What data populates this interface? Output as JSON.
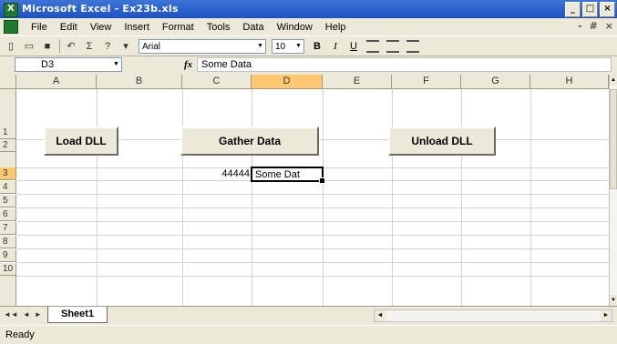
{
  "window": {
    "title": "Microsoft Excel - Ex23b.xls",
    "controls": {
      "minimize": "_",
      "restore": "□",
      "close": "×"
    }
  },
  "menu": {
    "items": [
      "File",
      "Edit",
      "View",
      "Insert",
      "Format",
      "Tools",
      "Data",
      "Window",
      "Help"
    ],
    "doc_controls": {
      "minimize": "-",
      "restore": "#",
      "close": "×"
    }
  },
  "toolbar": {
    "sum_label": "Σ",
    "font": "Arial",
    "size": "10",
    "bold": "B",
    "italic": "I",
    "underline": "U"
  },
  "formula_bar": {
    "name_box": "D3",
    "fx_label": "fx",
    "formula": "Some Data"
  },
  "columns": [
    "A",
    "B",
    "C",
    "D",
    "E",
    "F",
    "G",
    "H"
  ],
  "rows": [
    "1",
    "2",
    "3",
    "4",
    "5",
    "6",
    "7",
    "8",
    "9",
    "10"
  ],
  "selected": {
    "column": "D",
    "row": "3"
  },
  "cells": {
    "C3": "44444",
    "D3": "Some Dat"
  },
  "buttons": {
    "load_dll": "Load DLL",
    "gather_data": "Gather Data",
    "unload_dll": "Unload DLL"
  },
  "tabs": {
    "nav": [
      "◄◄",
      "◄",
      "►",
      "►►"
    ],
    "sheets": [
      "Sheet1"
    ]
  },
  "status": "Ready",
  "colors": {
    "title_bar": "#1d52c4",
    "selected_header": "#ffc870",
    "chrome": "#ece9d8"
  }
}
